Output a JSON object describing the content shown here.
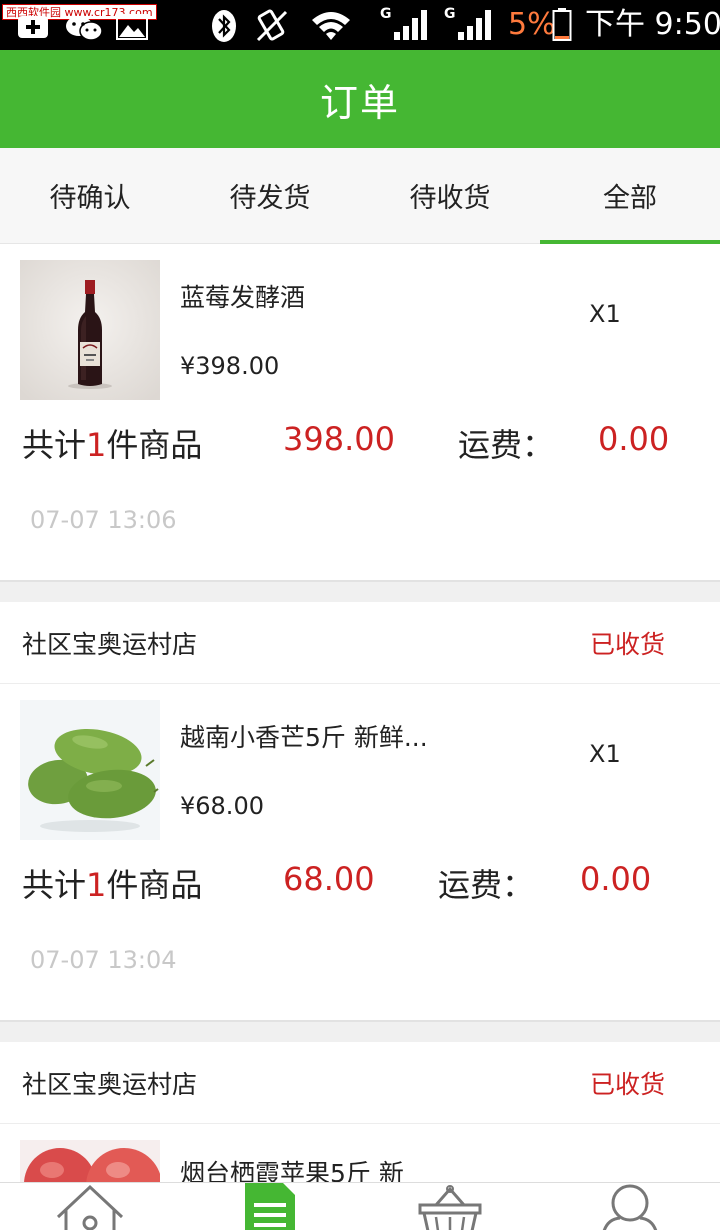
{
  "status_bar": {
    "watermark": "西西软件园 www.cr173.com",
    "network_1": "G",
    "network_2": "G",
    "battery": "5%",
    "time": "下午 9:50"
  },
  "header": {
    "title": "订单"
  },
  "tabs": [
    {
      "label": "待确认",
      "active": false
    },
    {
      "label": "待发货",
      "active": false
    },
    {
      "label": "待收货",
      "active": false
    },
    {
      "label": "全部",
      "active": true
    }
  ],
  "orders": [
    {
      "shop": "",
      "status": "",
      "item_name": "蓝莓发酵酒",
      "item_price": "¥398.00",
      "item_qty": "X1",
      "sum_prefix": "共计",
      "sum_count": "1",
      "sum_suffix": "件商品",
      "total": "398.00",
      "shipping_label": "运费：",
      "shipping_fee": "0.00",
      "time": "07-07 13:06",
      "thumb_icon": "wine-bottle-image"
    },
    {
      "shop": "社区宝奥运村店",
      "status": "已收货",
      "item_name": "越南小香芒5斤 新鲜...",
      "item_price": "¥68.00",
      "item_qty": "X1",
      "sum_prefix": "共计",
      "sum_count": "1",
      "sum_suffix": "件商品",
      "total": "68.00",
      "shipping_label": "运费：",
      "shipping_fee": "0.00",
      "time": "07-07 13:04",
      "thumb_icon": "mango-image"
    },
    {
      "shop": "社区宝奥运村店",
      "status": "已收货",
      "item_name": "烟台栖霞苹果5斤 新",
      "thumb_icon": "apple-image"
    }
  ],
  "bottom_nav": [
    {
      "icon": "home-icon",
      "active": false
    },
    {
      "icon": "orders-document-icon",
      "active": true
    },
    {
      "icon": "basket-icon",
      "active": false
    },
    {
      "icon": "user-icon",
      "active": false
    }
  ],
  "colors": {
    "brand_green": "#45b733",
    "price_red": "#cc2222",
    "battery_orange": "#ff7a3d",
    "time_gray": "#c8c8c8"
  }
}
